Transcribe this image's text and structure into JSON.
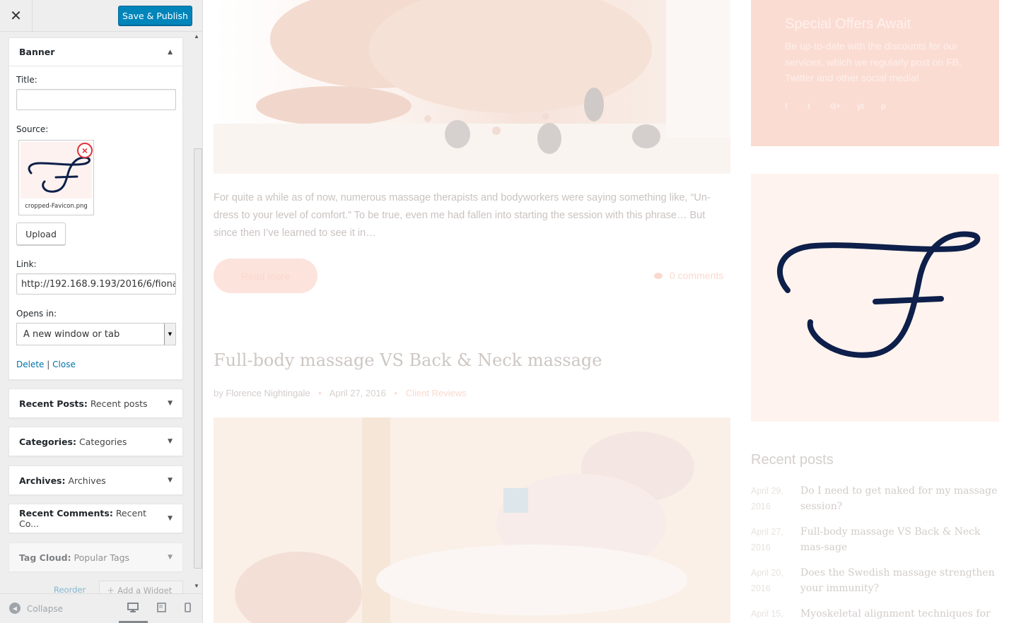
{
  "header": {
    "close_icon": "close-icon",
    "publish_label": "Save & Publish"
  },
  "banner_widget": {
    "title": "Banner",
    "title_label": "Title:",
    "title_value": "",
    "source_label": "Source:",
    "file_name": "cropped-Favicon.png",
    "upload_label": "Upload",
    "link_label": "Link:",
    "link_value": "http://192.168.9.193/2016/6/fiona",
    "opens_label": "Opens in:",
    "opens_value": "A new window or tab",
    "delete_label": "Delete",
    "separator": "|",
    "close_label": "Close"
  },
  "widgets": [
    {
      "name": "Recent Posts:",
      "title": "Recent posts"
    },
    {
      "name": "Categories:",
      "title": "Categories"
    },
    {
      "name": "Archives:",
      "title": "Archives"
    },
    {
      "name": "Recent Comments:",
      "title": "Recent Co..."
    },
    {
      "name": "Tag Cloud:",
      "title": "Popular Tags"
    }
  ],
  "widget_actions": {
    "reorder": "Reorder",
    "add_widget": "Add a Widget"
  },
  "footer": {
    "collapse_label": "Collapse"
  },
  "preview": {
    "excerpt": "For quite a while as of now, numerous massage therapists and bodyworkers were saying something like, “Un-dress to your level of comfort.” To be true, even me had fallen into starting the session with this phrase… But since then I’ve learned to see it in…",
    "read_more": "Read more",
    "comments": "0 comments",
    "post_title": "Full-body massage VS Back & Neck massage",
    "meta_by": "by",
    "meta_author": "Florence Nightingale",
    "meta_date": "April 27, 2016",
    "meta_category": "Client Reviews",
    "offers_title": "Special Offers Await",
    "offers_text": "Be up-to-date with the discounts for our services, which we regularly post on FB, Twitter and other social media!",
    "social": [
      "f",
      "t",
      "G+",
      "yt",
      "p"
    ],
    "recent_title": "Recent posts",
    "recent_posts": [
      {
        "date": "April 29, 2016",
        "title": "Do I need to get naked for my massage session?"
      },
      {
        "date": "April 27, 2016",
        "title": "Full-body massage VS Back & Neck mas-sage"
      },
      {
        "date": "April 20, 2016",
        "title": "Does the Swedish massage strengthen your immunity?"
      },
      {
        "date": "April 15,",
        "title": "Myoskeletal alignment techniques for"
      }
    ]
  },
  "colors": {
    "accent": "#0085ba",
    "link": "#0073aa",
    "remove": "#e0303a",
    "logo": "#0d1f4a"
  }
}
